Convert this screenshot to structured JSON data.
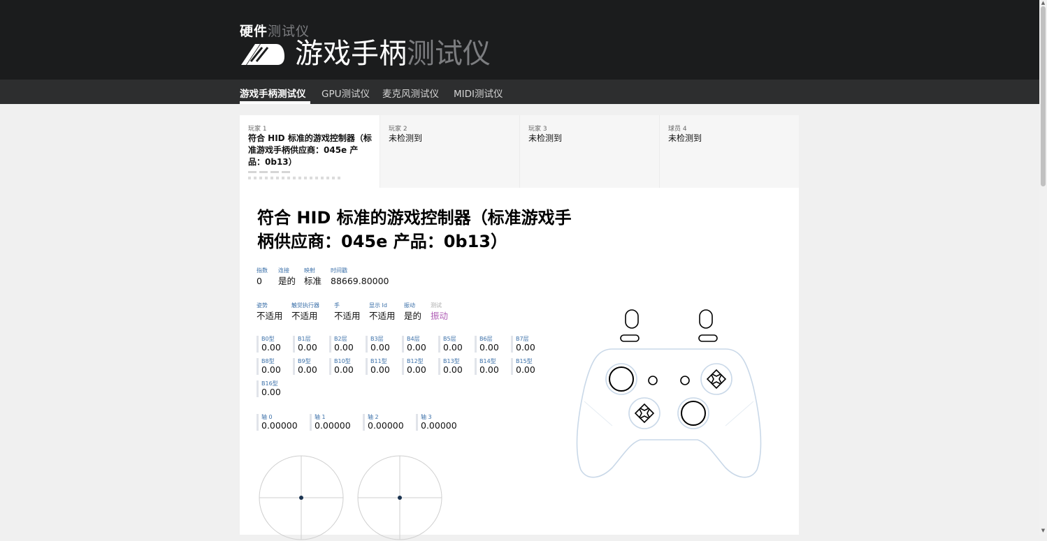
{
  "header": {
    "brand_small_bold": "硬件",
    "brand_small_light": "测试仪",
    "brand_big_bold": "游戏手柄",
    "brand_big_light": "测试仪",
    "logo_icon": "gamepad-logo-icon"
  },
  "nav": {
    "items": [
      {
        "label": "游戏手柄测试仪",
        "active": true
      },
      {
        "label": "GPU测试仪"
      },
      {
        "label": "麦克风测试仪"
      },
      {
        "label": "MIDI测试仪"
      }
    ]
  },
  "tabs": [
    {
      "label": "玩家 1",
      "name": "符合 HID 标准的游戏控制器（标准游戏手柄供应商：045e 产品：0b13）",
      "active": true
    },
    {
      "label": "玩家 2",
      "name": "未检测到"
    },
    {
      "label": "玩家 3",
      "name": "未检测到"
    },
    {
      "label": "球员 4",
      "name": "未检测到"
    }
  ],
  "controller": {
    "title": "符合 HID 标准的游戏控制器（标准游戏手柄供应商：045e 产品：0b13）",
    "info_row1": [
      {
        "k": "指数",
        "v": "0"
      },
      {
        "k": "连接",
        "v": "是的"
      },
      {
        "k": "映射",
        "v": "标准"
      },
      {
        "k": "时间戳",
        "v": "88669.80000"
      }
    ],
    "info_row2": [
      {
        "k": "姿势",
        "v": "不适用"
      },
      {
        "k": "触觉执行器",
        "v": "不适用"
      },
      {
        "k": "手",
        "v": "不适用"
      },
      {
        "k": "显示 Id",
        "v": "不适用"
      },
      {
        "k": "振动",
        "v": "是的"
      },
      {
        "k": "测试",
        "v": "振动"
      }
    ],
    "buttons": [
      {
        "k": "B0型",
        "v": "0.00"
      },
      {
        "k": "B1层",
        "v": "0.00"
      },
      {
        "k": "B2层",
        "v": "0.00"
      },
      {
        "k": "B3层",
        "v": "0.00"
      },
      {
        "k": "B4层",
        "v": "0.00"
      },
      {
        "k": "B5层",
        "v": "0.00"
      },
      {
        "k": "B6层",
        "v": "0.00"
      },
      {
        "k": "B7层",
        "v": "0.00"
      },
      {
        "k": "B8型",
        "v": "0.00"
      },
      {
        "k": "B9型",
        "v": "0.00"
      },
      {
        "k": "B10型",
        "v": "0.00"
      },
      {
        "k": "B11型",
        "v": "0.00"
      },
      {
        "k": "B12型",
        "v": "0.00"
      },
      {
        "k": "B13型",
        "v": "0.00"
      },
      {
        "k": "B14型",
        "v": "0.00"
      },
      {
        "k": "B15型",
        "v": "0.00"
      },
      {
        "k": "B16型",
        "v": "0.00"
      }
    ],
    "axes": [
      {
        "k": "轴 0",
        "v": "0.00000"
      },
      {
        "k": "轴 1",
        "v": "0.00000"
      },
      {
        "k": "轴 2",
        "v": "0.00000"
      },
      {
        "k": "轴 3",
        "v": "0.00000"
      }
    ]
  },
  "colors": {
    "header_bg": "#1b1c1d",
    "nav_bg": "#2d2e2f",
    "label_blue": "#3a6fa8",
    "link_purple": "#b05fb6",
    "controller_outline": "#c9d8e8"
  }
}
